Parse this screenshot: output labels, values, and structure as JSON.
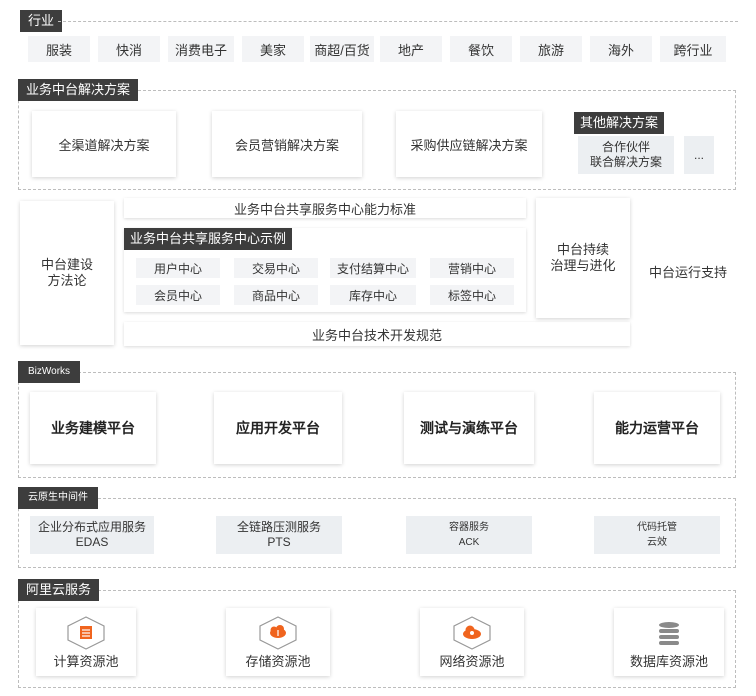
{
  "industry": {
    "title": "行业",
    "items": [
      "服装",
      "快消",
      "消费电子",
      "美家",
      "商超/百货",
      "地产",
      "餐饮",
      "旅游",
      "海外",
      "跨行业"
    ]
  },
  "solutions": {
    "title": "业务中台解决方案",
    "items": [
      "全渠道解决方案",
      "会员营销解决方案",
      "采购供应链解决方案"
    ],
    "other": {
      "title": "其他解决方案",
      "partner_line1": "合作伙伴",
      "partner_line2": "联合解决方案",
      "more": "..."
    }
  },
  "method": {
    "left_line1": "中台建设",
    "left_line2": "方法论",
    "standard": "业务中台共享服务中心能力标准",
    "example_title": "业务中台共享服务中心示例",
    "centers": [
      "用户中心",
      "交易中心",
      "支付结算中心",
      "营销中心",
      "会员中心",
      "商品中心",
      "库存中心",
      "标签中心"
    ],
    "tech_spec": "业务中台技术开发规范",
    "governance_line1": "中台持续",
    "governance_line2": "治理与进化",
    "ops_support": "中台运行支持"
  },
  "bizworks": {
    "title": "BizWorks",
    "items": [
      "业务建模平台",
      "应用开发平台",
      "测试与演练平台",
      "能力运营平台"
    ]
  },
  "middleware": {
    "title": "云原生中间件",
    "items": [
      {
        "line1": "企业分布式应用服务",
        "line2": "EDAS"
      },
      {
        "line1": "全链路压测服务",
        "line2": "PTS"
      },
      {
        "line1": "容器服务",
        "line2": "ACK"
      },
      {
        "line1": "代码托管",
        "line2": "云效"
      }
    ]
  },
  "aliyun": {
    "title": "阿里云服务",
    "items": [
      {
        "label": "计算资源池",
        "icon": "compute-icon"
      },
      {
        "label": "存储资源池",
        "icon": "storage-icon"
      },
      {
        "label": "网络资源池",
        "icon": "network-icon"
      },
      {
        "label": "数据库资源池",
        "icon": "database-icon"
      }
    ]
  },
  "colors": {
    "header_bg": "#3d3d3d",
    "accent_orange": "#f0641e",
    "chip_bg": "#f3f4f6"
  }
}
